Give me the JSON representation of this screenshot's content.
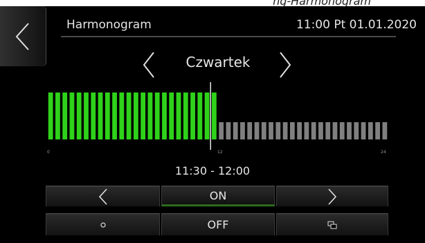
{
  "top_strip_text": "ng-Harmonogram",
  "header": {
    "title": "Harmonogram",
    "datetime": "11:00  Pt 01.01.2020"
  },
  "day_selector": {
    "day": "Czwartek"
  },
  "schedule": {
    "slot_minutes": 30,
    "on_slots": 24,
    "total_slots": 48,
    "current_time": "11:30",
    "axis_ticks": [
      "0",
      "12",
      "24"
    ],
    "on_color": "#2fd21a",
    "off_color": "#808080"
  },
  "time_range": "11:30 - 12:00",
  "buttons": {
    "on_label": "ON",
    "off_label": "OFF",
    "small_circle_icon": "circle-icon",
    "copy_icon": "copy-icon"
  }
}
